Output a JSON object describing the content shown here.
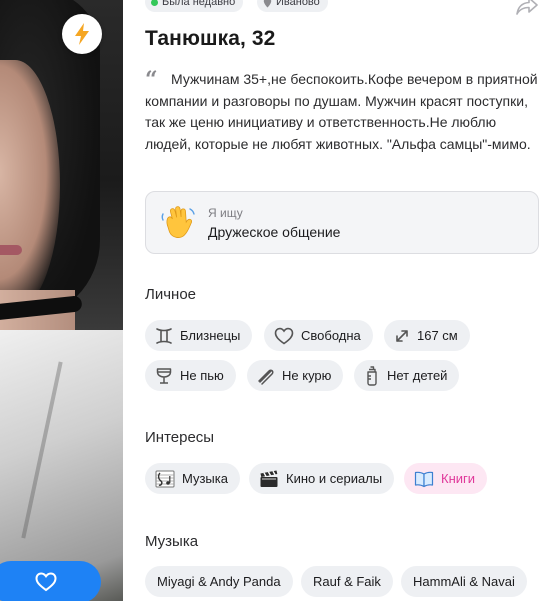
{
  "status": {
    "online": "Была недавно",
    "city": "Иваново"
  },
  "profile": {
    "name": "Танюшка, 32",
    "bio": "Мужчинам 35+,не беспокоить.Кофе вечером в приятной компании и разговоры по душам. Мужчин красят поступки, так же ценю инициативу и ответственность.Не люблю людей, которые не любят животных. \"Альфа самцы\"-мимо."
  },
  "seeking": {
    "label": "Я ищу",
    "value": "Дружеское общение",
    "icon": "waving-hand-icon"
  },
  "personal": {
    "title": "Личное",
    "items": [
      {
        "label": "Близнецы",
        "icon": "gemini-icon"
      },
      {
        "label": "Свободна",
        "icon": "heart-outline-icon"
      },
      {
        "label": "167 см",
        "icon": "height-arrows-icon"
      },
      {
        "label": "Не пью",
        "icon": "glass-icon"
      },
      {
        "label": "Не курю",
        "icon": "no-smoking-icon"
      },
      {
        "label": "Нет детей",
        "icon": "baby-bottle-icon"
      }
    ]
  },
  "interests": {
    "title": "Интересы",
    "items": [
      {
        "label": "Музыка",
        "icon": "music-notes-icon"
      },
      {
        "label": "Кино и сериалы",
        "icon": "clapper-board-icon"
      },
      {
        "label": "Книги",
        "icon": "books-icon",
        "highlighted": true
      }
    ]
  },
  "music": {
    "title": "Музыка",
    "items": [
      {
        "label": "Miyagi & Andy Panda"
      },
      {
        "label": "Rauf & Faik"
      },
      {
        "label": "HammAli & Navai"
      }
    ]
  },
  "colors": {
    "accent": "#1e82f5",
    "pill_bg": "#eef0f3",
    "highlight_bg": "#fde7f3",
    "highlight_text": "#e0389a",
    "bolt": "#f5a623"
  }
}
